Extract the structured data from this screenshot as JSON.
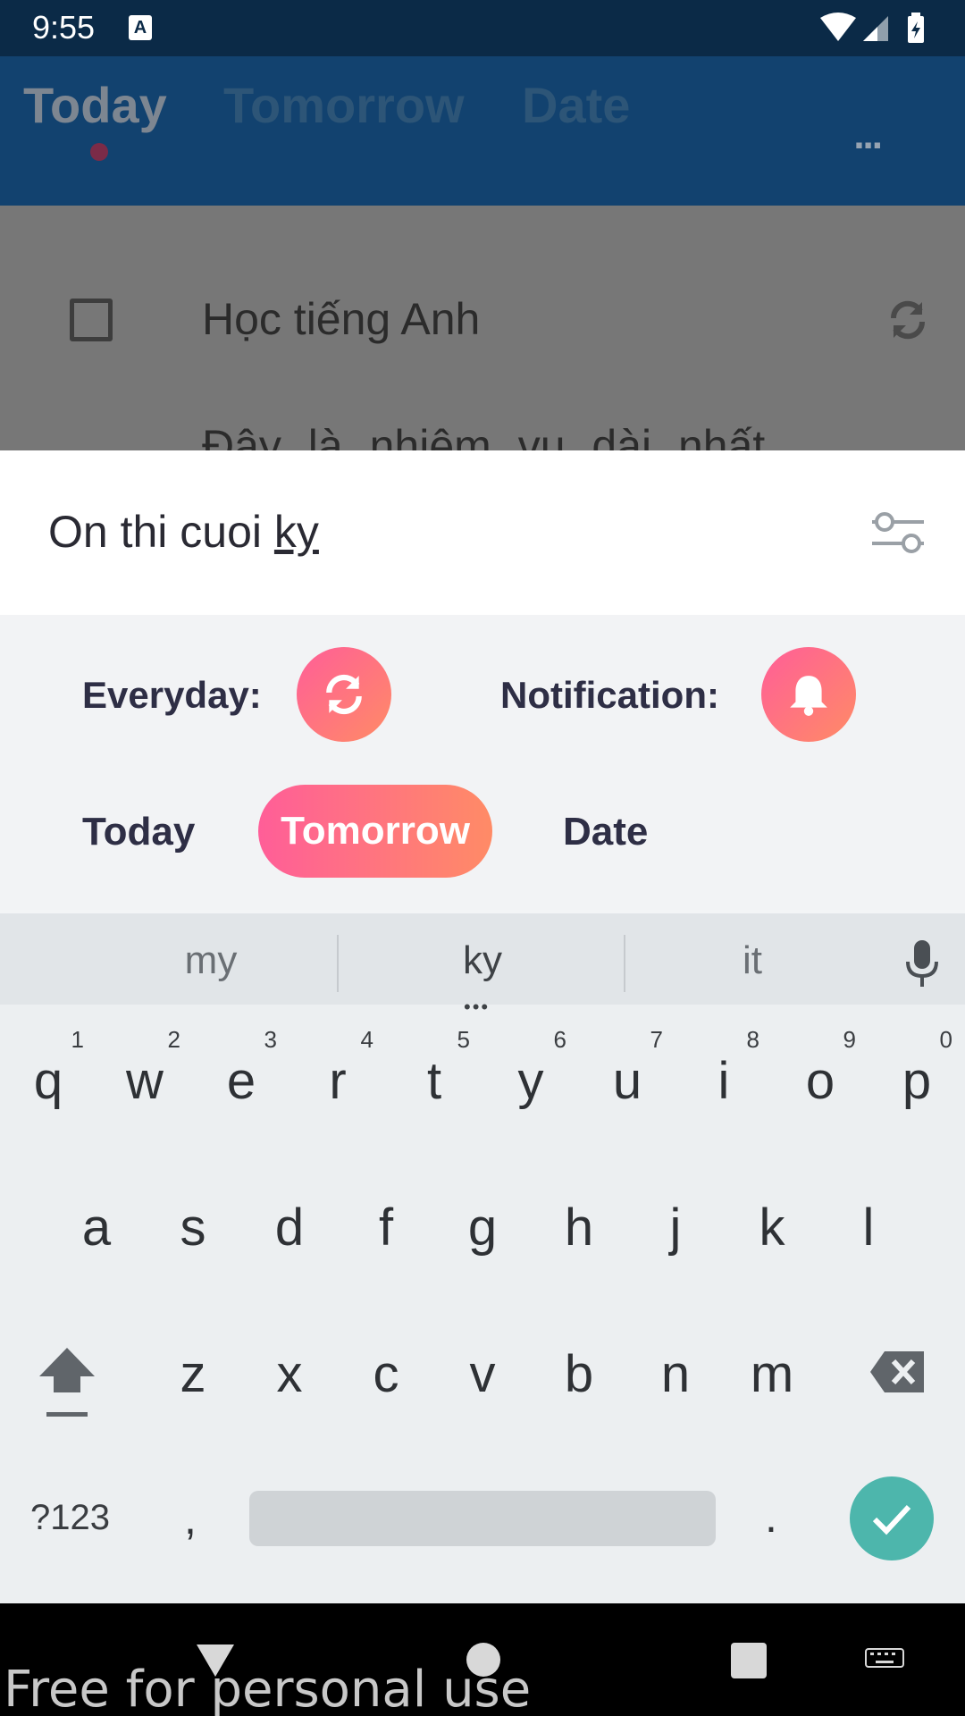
{
  "status_bar": {
    "time": "9:55",
    "notification_icon": "A"
  },
  "app_bar": {
    "tabs": [
      {
        "label": "Today",
        "active": true
      },
      {
        "label": "Tomorrow",
        "active": false
      },
      {
        "label": "Date",
        "active": false
      }
    ],
    "more_icon": "..."
  },
  "task_list": {
    "items": [
      {
        "title": "Học tiếng Anh",
        "subtitle": "Đây là nhiệm vụ dài nhất"
      }
    ]
  },
  "new_task": {
    "text_plain": "On thi cuoi ",
    "text_composing": "ky",
    "filter_icon": "sliders-icon"
  },
  "options": {
    "everyday_label": "Everyday:",
    "notification_label": "Notification:",
    "dates": [
      "Today",
      "Tomorrow",
      "Date"
    ],
    "selected_date": "Tomorrow",
    "accent_gradient": [
      "#FF5E98",
      "#FF8B66"
    ]
  },
  "keyboard": {
    "suggestions": [
      "my",
      "ky",
      "it"
    ],
    "row1": [
      {
        "l": "q",
        "n": "1"
      },
      {
        "l": "w",
        "n": "2"
      },
      {
        "l": "e",
        "n": "3"
      },
      {
        "l": "r",
        "n": "4"
      },
      {
        "l": "t",
        "n": "5"
      },
      {
        "l": "y",
        "n": "6"
      },
      {
        "l": "u",
        "n": "7"
      },
      {
        "l": "i",
        "n": "8"
      },
      {
        "l": "o",
        "n": "9"
      },
      {
        "l": "p",
        "n": "0"
      }
    ],
    "row2": [
      "a",
      "s",
      "d",
      "f",
      "g",
      "h",
      "j",
      "k",
      "l"
    ],
    "row3": [
      "z",
      "x",
      "c",
      "v",
      "b",
      "n",
      "m"
    ],
    "symbols_label": "?123",
    "comma": ",",
    "period": "."
  },
  "watermark": "Free for personal use"
}
